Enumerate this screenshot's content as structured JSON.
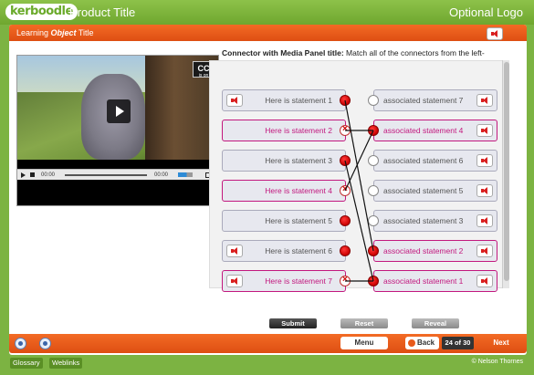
{
  "header": {
    "logo_text": "kerboodle",
    "product_title": "Product Title",
    "optional_logo": "Optional Logo"
  },
  "card": {
    "title_prefix": "Learning ",
    "title_italic": "Object",
    "title_suffix": " Title"
  },
  "video": {
    "cc_label": "CC",
    "cc_sub": "is on",
    "time_current": "00:00",
    "time_total": "00:00"
  },
  "instructions": {
    "title": "Connector with Media Panel title:",
    "text": " Match all of the connectors from the left-hand column with those in the right-hand column."
  },
  "left_statements": [
    {
      "label": "Here is statement 1",
      "active": false,
      "speaker": true,
      "dot": "filled"
    },
    {
      "label": "Here is statement 2",
      "active": true,
      "speaker": false,
      "dot": "x"
    },
    {
      "label": "Here is statement 3",
      "active": false,
      "speaker": false,
      "dot": "filled"
    },
    {
      "label": "Here is statement 4",
      "active": true,
      "speaker": false,
      "dot": "x"
    },
    {
      "label": "Here is statement 5",
      "active": false,
      "speaker": false,
      "dot": "filled"
    },
    {
      "label": "Here is statement 6",
      "active": false,
      "speaker": true,
      "dot": "filled"
    },
    {
      "label": "Here is statement 7",
      "active": true,
      "speaker": true,
      "dot": "x"
    }
  ],
  "right_statements": [
    {
      "label": "associated statement 7",
      "active": false,
      "speaker": true,
      "dot": "empty"
    },
    {
      "label": "associated statement 4",
      "active": true,
      "speaker": true,
      "dot": "filled"
    },
    {
      "label": "associated statement 6",
      "active": false,
      "speaker": true,
      "dot": "empty"
    },
    {
      "label": "associated statement 5",
      "active": false,
      "speaker": true,
      "dot": "empty"
    },
    {
      "label": "associated statement 3",
      "active": false,
      "speaker": true,
      "dot": "empty"
    },
    {
      "label": "associated statement 2",
      "active": true,
      "speaker": true,
      "dot": "filled"
    },
    {
      "label": "associated statement 1",
      "active": true,
      "speaker": true,
      "dot": "filled"
    }
  ],
  "connections": [
    [
      0,
      5
    ],
    [
      1,
      1
    ],
    [
      2,
      6
    ],
    [
      3,
      1
    ],
    [
      6,
      6
    ]
  ],
  "actions": {
    "submit": "Submit",
    "reset": "Reset",
    "reveal": "Reveal"
  },
  "nav": {
    "menu": "Menu",
    "back": "Back",
    "page_count": "24 of 30",
    "next": "Next"
  },
  "footer": {
    "glossary": "Glossary",
    "weblinks": "Weblinks",
    "copyright": "© Nelson Thornes"
  },
  "colors": {
    "header_green": "#7cb342",
    "title_orange": "#ef5f1f",
    "active_magenta": "#c2187e",
    "connector_red": "#cc0000"
  }
}
